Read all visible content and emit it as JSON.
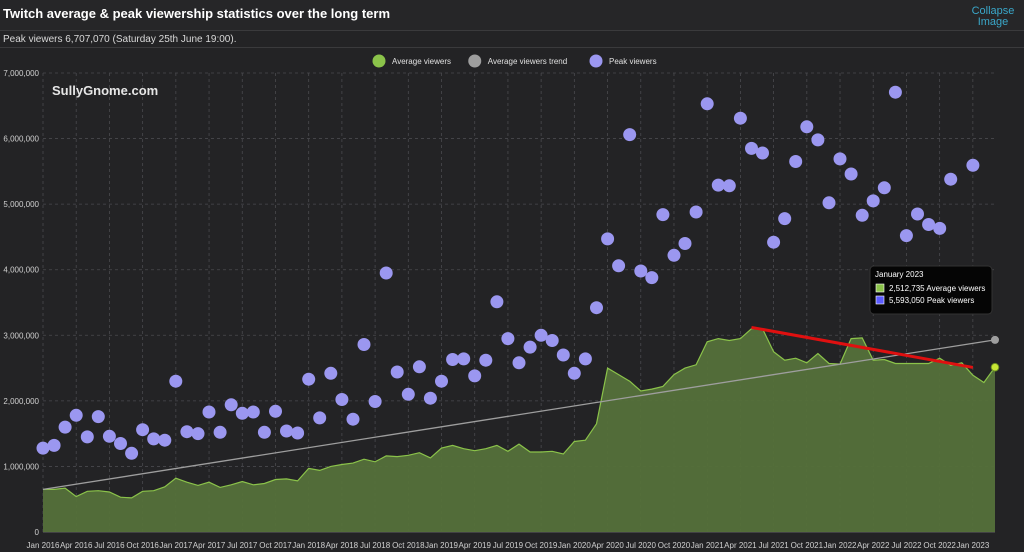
{
  "header": {
    "title": "Twitch average & peak viewership statistics over the long term",
    "collapse_label": "Collapse Image"
  },
  "subheader": {
    "text": "Peak viewers 6,707,070 (Saturday 25th June 19:00)."
  },
  "watermark": "SullyGnome.com",
  "tooltip": {
    "title": "January 2023",
    "rows": [
      {
        "text": "2,512,735 Average viewers",
        "color": "#8bc34a"
      },
      {
        "text": "5,593,050 Peak viewers",
        "color": "#5b5bff"
      }
    ]
  },
  "colors": {
    "average": "#8bc34a",
    "average_fill": "#55713a",
    "trend": "#9e9e9e",
    "peak": "#9b97f0",
    "highlight_peak": "#4a4af0",
    "red_line": "#e01010",
    "grid": "#4a4a4e"
  },
  "chart_data": {
    "type": "area",
    "title": "Twitch average & peak viewership statistics over the long term",
    "xlabel": "",
    "ylabel": "",
    "ylim": [
      0,
      7000000
    ],
    "yticks": [
      "0",
      "1,000,000",
      "2,000,000",
      "3,000,000",
      "4,000,000",
      "5,000,000",
      "6,000,000",
      "7,000,000"
    ],
    "grid": true,
    "legend_position": "top-center",
    "legend": [
      {
        "label": "Average viewers",
        "color": "#8bc34a"
      },
      {
        "label": "Average viewers trend",
        "color": "#9e9e9e"
      },
      {
        "label": "Peak viewers",
        "color": "#9b97f0"
      }
    ],
    "x_tick_labels": [
      "Jan 2016",
      "Apr 2016",
      "Jul 2016",
      "Oct 2016",
      "Jan 2017",
      "Apr 2017",
      "Jul 2017",
      "Oct 2017",
      "Jan 2018",
      "Apr 2018",
      "Jul 2018",
      "Oct 2018",
      "Jan 2019",
      "Apr 2019",
      "Jul 2019",
      "Oct 2019",
      "Jan 2020",
      "Apr 2020",
      "Jul 2020",
      "Oct 2020",
      "Jan 2021",
      "Apr 2021",
      "Jul 2021",
      "Oct 2021",
      "Jan 2022",
      "Apr 2022",
      "Jul 2022",
      "Oct 2022",
      "Jan 2023"
    ],
    "x_start": "2016-01",
    "series": [
      {
        "name": "Average viewers",
        "type": "area",
        "values": [
          650000,
          650000,
          670000,
          540000,
          620000,
          630000,
          610000,
          530000,
          520000,
          620000,
          630000,
          690000,
          820000,
          760000,
          710000,
          760000,
          680000,
          720000,
          770000,
          720000,
          740000,
          800000,
          810000,
          780000,
          970000,
          940000,
          1000000,
          1030000,
          1050000,
          1110000,
          1070000,
          1160000,
          1150000,
          1170000,
          1210000,
          1130000,
          1280000,
          1320000,
          1270000,
          1240000,
          1270000,
          1320000,
          1230000,
          1340000,
          1220000,
          1220000,
          1230000,
          1190000,
          1380000,
          1400000,
          1650000,
          2500000,
          2400000,
          2300000,
          2150000,
          2180000,
          2220000,
          2400000,
          2500000,
          2550000,
          2900000,
          2950000,
          2920000,
          2950000,
          3100000,
          3100000,
          2750000,
          2620000,
          2650000,
          2580000,
          2720000,
          2570000,
          2560000,
          2950000,
          2960000,
          2620000,
          2630000,
          2570000,
          2570000,
          2570000,
          2570000,
          2650000,
          2540000,
          2580000,
          2390000,
          2280000,
          2512735
        ]
      },
      {
        "name": "Peak viewers",
        "type": "scatter",
        "values": [
          1280000,
          1320000,
          1600000,
          1780000,
          1450000,
          1760000,
          1460000,
          1350000,
          1200000,
          1560000,
          1420000,
          1400000,
          2300000,
          1530000,
          1500000,
          1830000,
          1520000,
          1940000,
          1810000,
          1830000,
          1520000,
          1840000,
          1540000,
          1510000,
          2330000,
          1740000,
          2420000,
          2020000,
          1720000,
          2860000,
          1990000,
          3950000,
          2440000,
          2100000,
          2520000,
          2040000,
          2300000,
          2630000,
          2640000,
          2380000,
          2620000,
          3510000,
          2950000,
          2580000,
          2820000,
          3000000,
          2920000,
          2700000,
          2420000,
          2640000,
          3420000,
          4470000,
          4060000,
          6060000,
          3980000,
          3880000,
          4840000,
          4220000,
          4400000,
          4880000,
          6530000,
          5290000,
          5280000,
          6310000,
          5850000,
          5780000,
          4420000,
          4780000,
          5650000,
          6180000,
          5980000,
          5020000,
          5690000,
          5460000,
          4830000,
          5050000,
          5250000,
          6707070,
          4520000,
          4850000,
          4690000,
          4630000,
          5380000,
          null,
          5593050
        ]
      },
      {
        "name": "Average viewers trend",
        "type": "line",
        "values": [
          650000,
          2930000
        ]
      }
    ],
    "annotation": {
      "type": "line",
      "from_index": 64,
      "to_index": 84,
      "values": [
        3120000,
        2510000
      ],
      "color": "#e01010"
    }
  }
}
